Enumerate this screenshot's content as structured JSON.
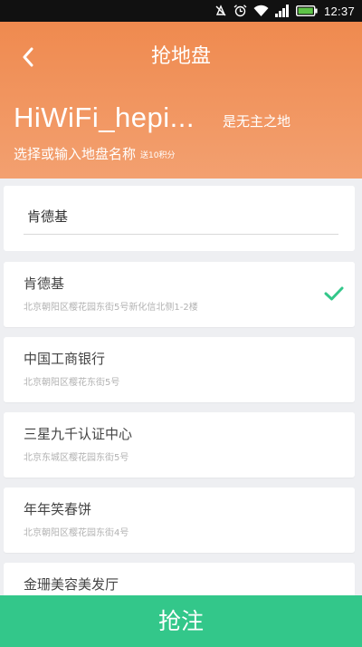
{
  "status_bar": {
    "time": "12:37"
  },
  "header": {
    "title": "抢地盘",
    "ssid": "HiWiFi_hepi...",
    "status_tag": "是无主之地",
    "subtitle": "选择或输入地盘名称",
    "points_note": "送10积分"
  },
  "input": {
    "value": "肯德基"
  },
  "places": [
    {
      "name": "肯德基",
      "address": "北京朝阳区樱花园东街5号新化信北侧1-2楼",
      "selected": true
    },
    {
      "name": "中国工商银行",
      "address": "北京朝阳区樱花东街5号",
      "selected": false
    },
    {
      "name": "三星九千认证中心",
      "address": "北京东城区樱花园东街5号",
      "selected": false
    },
    {
      "name": "年年笑春饼",
      "address": "北京朝阳区樱花园东街4号",
      "selected": false
    },
    {
      "name": "金珊美容美发厅",
      "address": "",
      "selected": false
    }
  ],
  "action": {
    "label": "抢注"
  },
  "colors": {
    "header": "#ef8a4f",
    "accent": "#33c78a"
  },
  "icons": {
    "back": "chevron-left-icon",
    "check": "check-icon",
    "wifi": "wifi-icon",
    "battery": "battery-icon",
    "alarm": "alarm-icon",
    "signal": "signal-icon"
  }
}
